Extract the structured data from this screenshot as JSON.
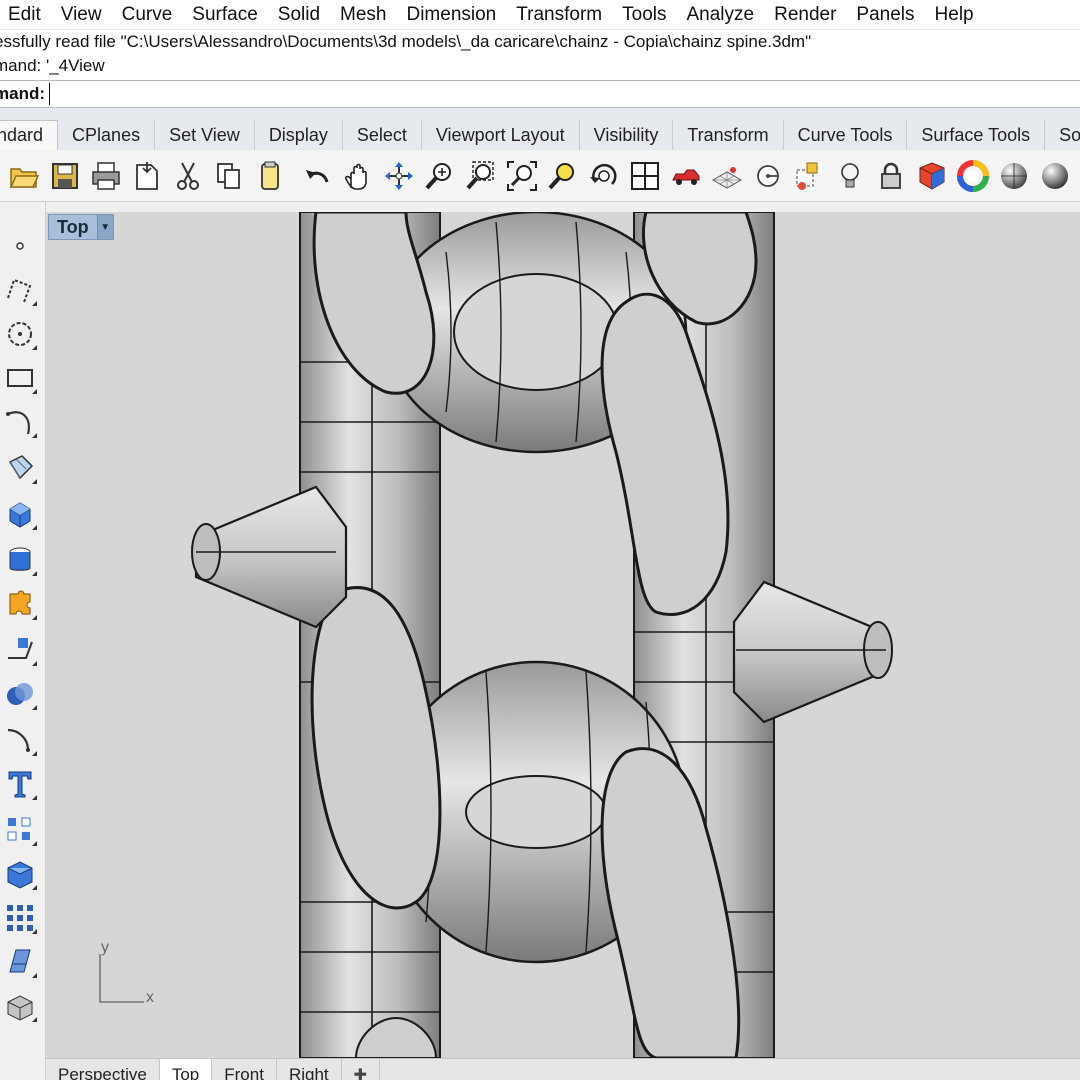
{
  "menu": [
    "Edit",
    "View",
    "Curve",
    "Surface",
    "Solid",
    "Mesh",
    "Dimension",
    "Transform",
    "Tools",
    "Analyze",
    "Render",
    "Panels",
    "Help"
  ],
  "command_history": [
    "essfully read file \"C:\\Users\\Alessandro\\Documents\\3d models\\_da caricare\\chainz - Copia\\chainz spine.3dm\"",
    "mand: '_4View"
  ],
  "command_prompt": {
    "label": "mand:",
    "value": ""
  },
  "tabs": [
    "ndard",
    "CPlanes",
    "Set View",
    "Display",
    "Select",
    "Viewport Layout",
    "Visibility",
    "Transform",
    "Curve Tools",
    "Surface Tools",
    "Solid T"
  ],
  "toolbar_icons": [
    "open-icon",
    "save-icon",
    "print-icon",
    "import-icon",
    "cut-icon",
    "copy-icon",
    "paste-icon",
    "undo-icon",
    "pan-icon",
    "rotate-view-icon",
    "zoom-icon",
    "zoom-window-icon",
    "zoom-extents-icon",
    "zoom-selected-icon",
    "rotate-icon",
    "four-view-icon",
    "car-icon",
    "grid-icon",
    "point-icon",
    "properties-icon",
    "light-icon",
    "lock-icon",
    "render-icon",
    "color-wheel-icon",
    "shaded-sphere-icon",
    "rendered-sphere-icon",
    "blue-sphere-icon"
  ],
  "sidebar_icons": [
    "point-icon",
    "polyline-icon",
    "circle-icon",
    "rectangle-icon",
    "curve-icon",
    "surface-icon",
    "box-icon",
    "cylinder-icon",
    "puzzle-icon",
    "transform-icon",
    "boolean-icon",
    "fillet-icon",
    "text-icon",
    "array-icon",
    "solid-tools-icon",
    "grid-array-icon",
    "extrude-icon",
    "solid-box-icon"
  ],
  "viewport": {
    "name": "Top",
    "axis_x": "x",
    "axis_y": "y"
  },
  "viewport_tabs": [
    "Perspective",
    "Top",
    "Front",
    "Right"
  ],
  "active_viewport_tab": "Top"
}
